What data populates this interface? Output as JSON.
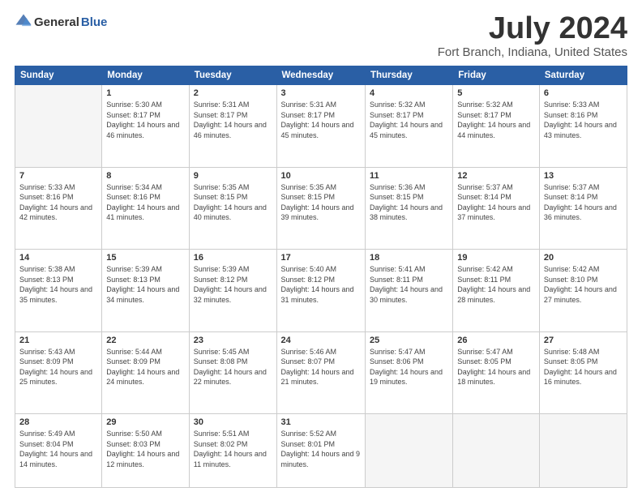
{
  "header": {
    "logo_general": "General",
    "logo_blue": "Blue",
    "month_title": "July 2024",
    "location": "Fort Branch, Indiana, United States"
  },
  "days_of_week": [
    "Sunday",
    "Monday",
    "Tuesday",
    "Wednesday",
    "Thursday",
    "Friday",
    "Saturday"
  ],
  "weeks": [
    [
      {
        "day": "",
        "empty": true
      },
      {
        "day": "1",
        "sunrise": "Sunrise: 5:30 AM",
        "sunset": "Sunset: 8:17 PM",
        "daylight": "Daylight: 14 hours and 46 minutes."
      },
      {
        "day": "2",
        "sunrise": "Sunrise: 5:31 AM",
        "sunset": "Sunset: 8:17 PM",
        "daylight": "Daylight: 14 hours and 46 minutes."
      },
      {
        "day": "3",
        "sunrise": "Sunrise: 5:31 AM",
        "sunset": "Sunset: 8:17 PM",
        "daylight": "Daylight: 14 hours and 45 minutes."
      },
      {
        "day": "4",
        "sunrise": "Sunrise: 5:32 AM",
        "sunset": "Sunset: 8:17 PM",
        "daylight": "Daylight: 14 hours and 45 minutes."
      },
      {
        "day": "5",
        "sunrise": "Sunrise: 5:32 AM",
        "sunset": "Sunset: 8:17 PM",
        "daylight": "Daylight: 14 hours and 44 minutes."
      },
      {
        "day": "6",
        "sunrise": "Sunrise: 5:33 AM",
        "sunset": "Sunset: 8:16 PM",
        "daylight": "Daylight: 14 hours and 43 minutes."
      }
    ],
    [
      {
        "day": "7",
        "sunrise": "Sunrise: 5:33 AM",
        "sunset": "Sunset: 8:16 PM",
        "daylight": "Daylight: 14 hours and 42 minutes."
      },
      {
        "day": "8",
        "sunrise": "Sunrise: 5:34 AM",
        "sunset": "Sunset: 8:16 PM",
        "daylight": "Daylight: 14 hours and 41 minutes."
      },
      {
        "day": "9",
        "sunrise": "Sunrise: 5:35 AM",
        "sunset": "Sunset: 8:15 PM",
        "daylight": "Daylight: 14 hours and 40 minutes."
      },
      {
        "day": "10",
        "sunrise": "Sunrise: 5:35 AM",
        "sunset": "Sunset: 8:15 PM",
        "daylight": "Daylight: 14 hours and 39 minutes."
      },
      {
        "day": "11",
        "sunrise": "Sunrise: 5:36 AM",
        "sunset": "Sunset: 8:15 PM",
        "daylight": "Daylight: 14 hours and 38 minutes."
      },
      {
        "day": "12",
        "sunrise": "Sunrise: 5:37 AM",
        "sunset": "Sunset: 8:14 PM",
        "daylight": "Daylight: 14 hours and 37 minutes."
      },
      {
        "day": "13",
        "sunrise": "Sunrise: 5:37 AM",
        "sunset": "Sunset: 8:14 PM",
        "daylight": "Daylight: 14 hours and 36 minutes."
      }
    ],
    [
      {
        "day": "14",
        "sunrise": "Sunrise: 5:38 AM",
        "sunset": "Sunset: 8:13 PM",
        "daylight": "Daylight: 14 hours and 35 minutes."
      },
      {
        "day": "15",
        "sunrise": "Sunrise: 5:39 AM",
        "sunset": "Sunset: 8:13 PM",
        "daylight": "Daylight: 14 hours and 34 minutes."
      },
      {
        "day": "16",
        "sunrise": "Sunrise: 5:39 AM",
        "sunset": "Sunset: 8:12 PM",
        "daylight": "Daylight: 14 hours and 32 minutes."
      },
      {
        "day": "17",
        "sunrise": "Sunrise: 5:40 AM",
        "sunset": "Sunset: 8:12 PM",
        "daylight": "Daylight: 14 hours and 31 minutes."
      },
      {
        "day": "18",
        "sunrise": "Sunrise: 5:41 AM",
        "sunset": "Sunset: 8:11 PM",
        "daylight": "Daylight: 14 hours and 30 minutes."
      },
      {
        "day": "19",
        "sunrise": "Sunrise: 5:42 AM",
        "sunset": "Sunset: 8:11 PM",
        "daylight": "Daylight: 14 hours and 28 minutes."
      },
      {
        "day": "20",
        "sunrise": "Sunrise: 5:42 AM",
        "sunset": "Sunset: 8:10 PM",
        "daylight": "Daylight: 14 hours and 27 minutes."
      }
    ],
    [
      {
        "day": "21",
        "sunrise": "Sunrise: 5:43 AM",
        "sunset": "Sunset: 8:09 PM",
        "daylight": "Daylight: 14 hours and 25 minutes."
      },
      {
        "day": "22",
        "sunrise": "Sunrise: 5:44 AM",
        "sunset": "Sunset: 8:09 PM",
        "daylight": "Daylight: 14 hours and 24 minutes."
      },
      {
        "day": "23",
        "sunrise": "Sunrise: 5:45 AM",
        "sunset": "Sunset: 8:08 PM",
        "daylight": "Daylight: 14 hours and 22 minutes."
      },
      {
        "day": "24",
        "sunrise": "Sunrise: 5:46 AM",
        "sunset": "Sunset: 8:07 PM",
        "daylight": "Daylight: 14 hours and 21 minutes."
      },
      {
        "day": "25",
        "sunrise": "Sunrise: 5:47 AM",
        "sunset": "Sunset: 8:06 PM",
        "daylight": "Daylight: 14 hours and 19 minutes."
      },
      {
        "day": "26",
        "sunrise": "Sunrise: 5:47 AM",
        "sunset": "Sunset: 8:05 PM",
        "daylight": "Daylight: 14 hours and 18 minutes."
      },
      {
        "day": "27",
        "sunrise": "Sunrise: 5:48 AM",
        "sunset": "Sunset: 8:05 PM",
        "daylight": "Daylight: 14 hours and 16 minutes."
      }
    ],
    [
      {
        "day": "28",
        "sunrise": "Sunrise: 5:49 AM",
        "sunset": "Sunset: 8:04 PM",
        "daylight": "Daylight: 14 hours and 14 minutes."
      },
      {
        "day": "29",
        "sunrise": "Sunrise: 5:50 AM",
        "sunset": "Sunset: 8:03 PM",
        "daylight": "Daylight: 14 hours and 12 minutes."
      },
      {
        "day": "30",
        "sunrise": "Sunrise: 5:51 AM",
        "sunset": "Sunset: 8:02 PM",
        "daylight": "Daylight: 14 hours and 11 minutes."
      },
      {
        "day": "31",
        "sunrise": "Sunrise: 5:52 AM",
        "sunset": "Sunset: 8:01 PM",
        "daylight": "Daylight: 14 hours and 9 minutes."
      },
      {
        "day": "",
        "empty": true
      },
      {
        "day": "",
        "empty": true
      },
      {
        "day": "",
        "empty": true
      }
    ]
  ]
}
